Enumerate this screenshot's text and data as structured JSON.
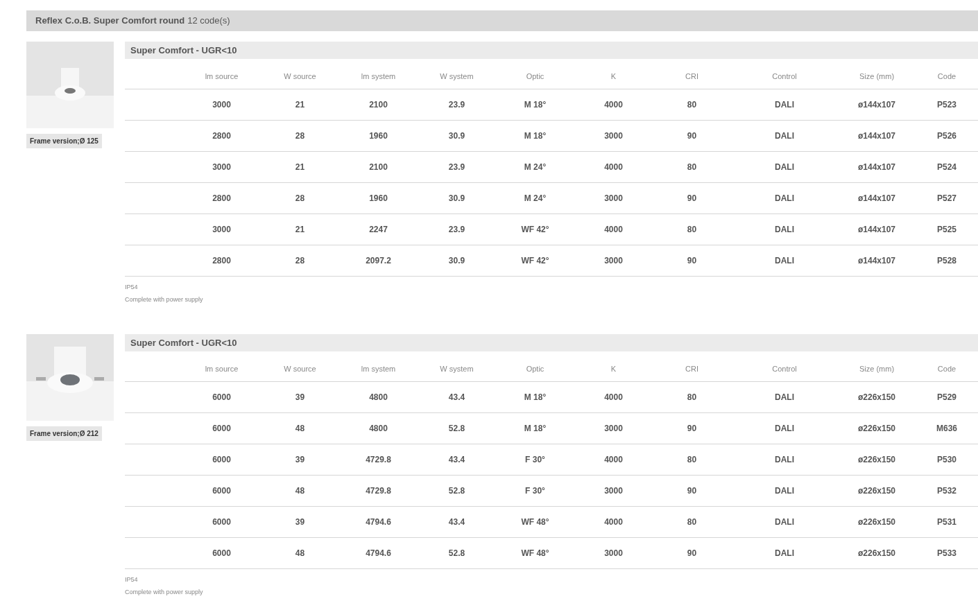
{
  "header": {
    "title": "Reflex C.o.B. Super Comfort round",
    "count": "12 code(s)"
  },
  "sections": [
    {
      "image_caption": "Frame version;Ø 125",
      "kind": "small",
      "subtitle": "Super Comfort - UGR<10",
      "columns": [
        "lm source",
        "W source",
        "lm system",
        "W system",
        "Optic",
        "K",
        "CRI",
        "Control",
        "Size (mm)",
        "Code"
      ],
      "rows": [
        [
          "3000",
          "21",
          "2100",
          "23.9",
          "M 18°",
          "4000",
          "80",
          "DALI",
          "ø144x107",
          "P523"
        ],
        [
          "2800",
          "28",
          "1960",
          "30.9",
          "M 18°",
          "3000",
          "90",
          "DALI",
          "ø144x107",
          "P526"
        ],
        [
          "3000",
          "21",
          "2100",
          "23.9",
          "M 24°",
          "4000",
          "80",
          "DALI",
          "ø144x107",
          "P524"
        ],
        [
          "2800",
          "28",
          "1960",
          "30.9",
          "M 24°",
          "3000",
          "90",
          "DALI",
          "ø144x107",
          "P527"
        ],
        [
          "3000",
          "21",
          "2247",
          "23.9",
          "WF 42°",
          "4000",
          "80",
          "DALI",
          "ø144x107",
          "P525"
        ],
        [
          "2800",
          "28",
          "2097.2",
          "30.9",
          "WF 42°",
          "3000",
          "90",
          "DALI",
          "ø144x107",
          "P528"
        ]
      ],
      "notes": [
        "IP54",
        "Complete with power supply"
      ]
    },
    {
      "image_caption": "Frame version;Ø 212",
      "kind": "large",
      "subtitle": "Super Comfort - UGR<10",
      "columns": [
        "lm source",
        "W source",
        "lm system",
        "W system",
        "Optic",
        "K",
        "CRI",
        "Control",
        "Size (mm)",
        "Code"
      ],
      "rows": [
        [
          "6000",
          "39",
          "4800",
          "43.4",
          "M 18°",
          "4000",
          "80",
          "DALI",
          "ø226x150",
          "P529"
        ],
        [
          "6000",
          "48",
          "4800",
          "52.8",
          "M 18°",
          "3000",
          "90",
          "DALI",
          "ø226x150",
          "M636"
        ],
        [
          "6000",
          "39",
          "4729.8",
          "43.4",
          "F 30°",
          "4000",
          "80",
          "DALI",
          "ø226x150",
          "P530"
        ],
        [
          "6000",
          "48",
          "4729.8",
          "52.8",
          "F 30°",
          "3000",
          "90",
          "DALI",
          "ø226x150",
          "P532"
        ],
        [
          "6000",
          "39",
          "4794.6",
          "43.4",
          "WF 48°",
          "4000",
          "80",
          "DALI",
          "ø226x150",
          "P531"
        ],
        [
          "6000",
          "48",
          "4794.6",
          "52.8",
          "WF 48°",
          "3000",
          "90",
          "DALI",
          "ø226x150",
          "P533"
        ]
      ],
      "notes": [
        "IP54",
        "Complete with power supply"
      ]
    }
  ]
}
